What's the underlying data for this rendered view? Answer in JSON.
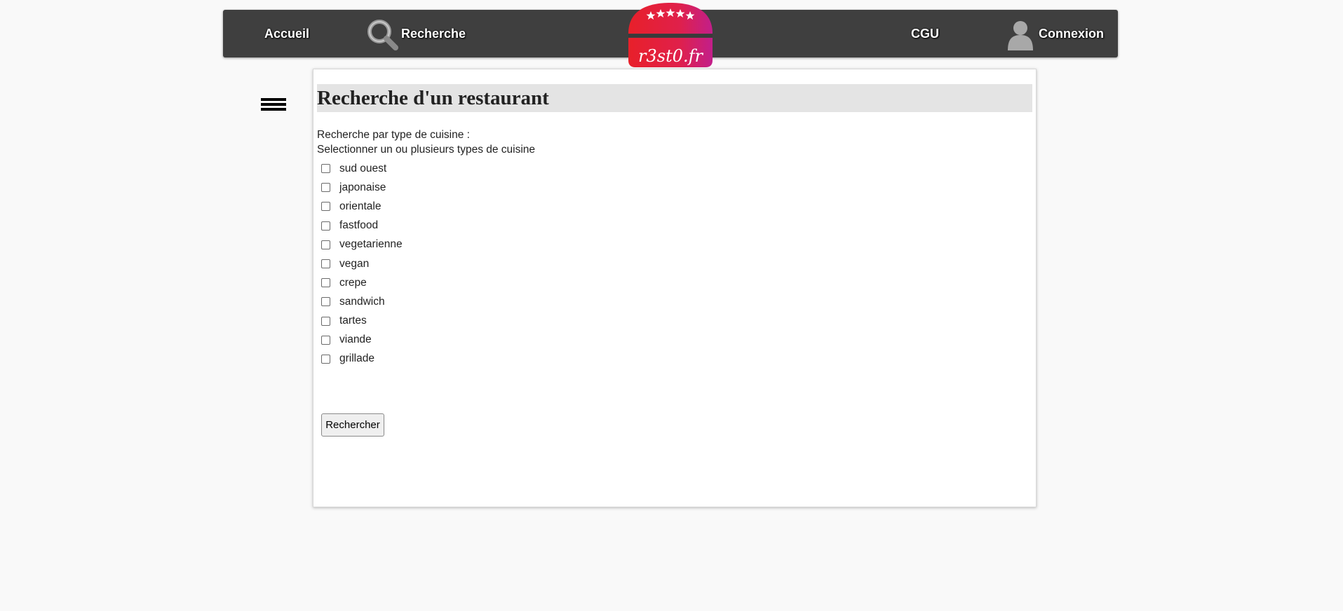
{
  "nav": {
    "home_label": "Accueil",
    "search_label": "Recherche",
    "terms_label": "CGU",
    "login_label": "Connexion"
  },
  "logo": {
    "text": "r3st0.fr",
    "stars": 5,
    "colors": {
      "red": "#e8202a",
      "magenta": "#c21f8a"
    }
  },
  "page": {
    "title": "Recherche d'un restaurant",
    "intro_line1": "Recherche par type de cuisine :",
    "intro_line2": "Selectionner un ou plusieurs types de cuisine"
  },
  "cuisine_types": [
    "sud ouest",
    "japonaise",
    "orientale",
    "fastfood",
    "vegetarienne",
    "vegan",
    "crepe",
    "sandwich",
    "tartes",
    "viande",
    "grillade"
  ],
  "form": {
    "submit_label": "Rechercher"
  },
  "colors": {
    "navbar_bg": "#3f3f3f",
    "page_bg": "#f9f9f9",
    "title_bg": "#e4e4e4"
  },
  "icons": {
    "search": "magnifier-icon",
    "user": "user-icon",
    "menu": "hamburger-icon"
  }
}
